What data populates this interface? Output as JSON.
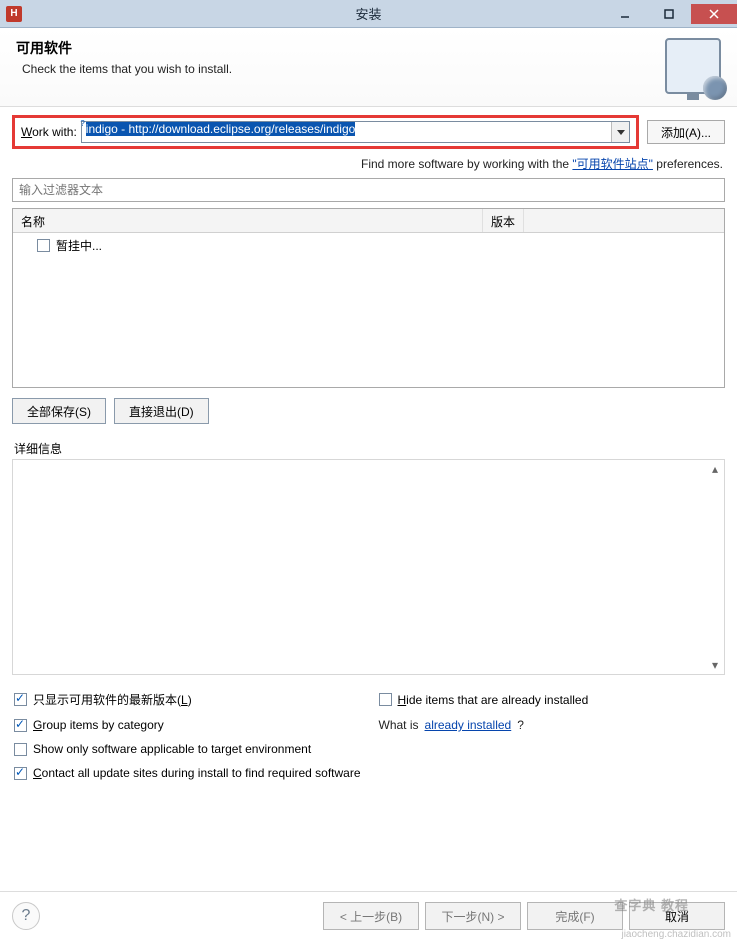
{
  "window": {
    "title": "安装"
  },
  "banner": {
    "title": "可用软件",
    "subtitle": "Check the items that you wish to install."
  },
  "workwith": {
    "label_pre": "W",
    "label_post": "ork with:",
    "value": "indigo - http://download.eclipse.org/releases/indigo",
    "add_button": "添加(A)..."
  },
  "findmore": {
    "prefix": "Find more software by working with the ",
    "link": "\"可用软件站点\"",
    "suffix": " preferences."
  },
  "filter": {
    "placeholder": "输入过滤器文本"
  },
  "tree": {
    "headers": {
      "name": "名称",
      "version": "版本"
    },
    "rows": [
      {
        "label": "暂挂中...",
        "checked": false
      }
    ]
  },
  "buttons": {
    "select_all": "全部保存(S)",
    "deselect_all": "直接退出(D)"
  },
  "details": {
    "label": "详细信息"
  },
  "options": {
    "latest_only": {
      "label_pre": "只显示可用软件的最新版本(",
      "accel": "L",
      "label_post": ")",
      "checked": true
    },
    "hide_installed": {
      "label_pre": "H",
      "label_post": "ide items that are already installed",
      "checked": false
    },
    "group_by_cat": {
      "label_pre": "G",
      "label_post": "roup items by category",
      "checked": true
    },
    "what_is": {
      "prefix": "What is ",
      "link": "already installed",
      "suffix": "?"
    },
    "target_env": {
      "label": "Show only software applicable to target environment",
      "checked": false
    },
    "contact_all": {
      "label_pre": "C",
      "label_post": "ontact all update sites during install to find required software",
      "checked": true
    }
  },
  "wizard": {
    "back": "< 上一步(B)",
    "next": "下一步(N) >",
    "finish": "完成(F)",
    "cancel": "取消"
  },
  "watermark": {
    "big": "查字典 教程",
    "small": "jiaocheng.chazidian.com"
  }
}
